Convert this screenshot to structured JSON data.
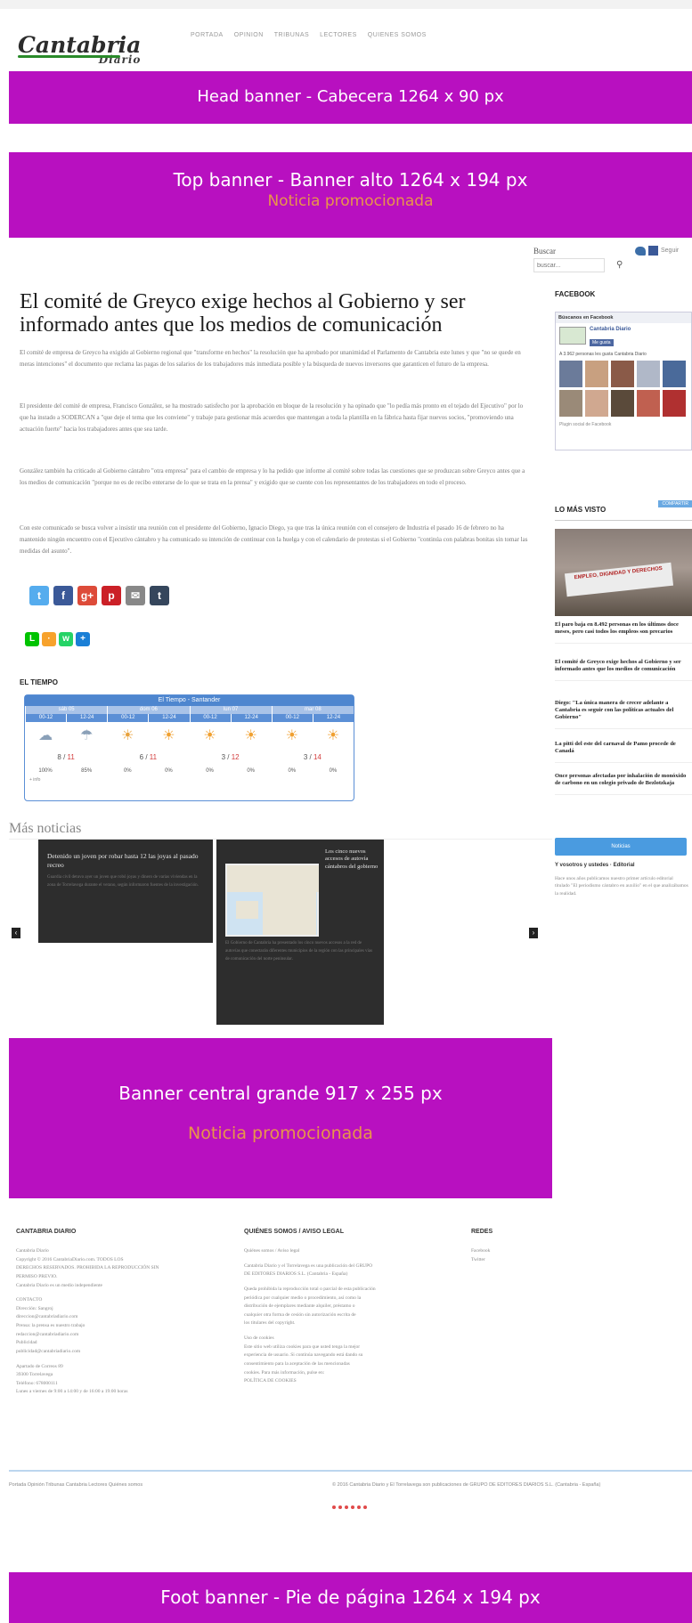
{
  "logo": {
    "name": "Cantabria",
    "sub": "Diario"
  },
  "nav": [
    "PORTADA",
    "OPINION",
    "TRIBUNAS",
    "LECTORES",
    "QUIENES SOMOS"
  ],
  "banners": {
    "head": "Head banner - Cabecera    1264 x 90 px",
    "top": "Top banner - Banner alto    1264 x 194 px",
    "top_promo": "Noticia promocionada",
    "central": "Banner central  grande  917 x 255 px",
    "central_promo": "Noticia promocionada",
    "foot": "Foot banner  - Pie de página  1264 x 194 px"
  },
  "search": {
    "label": "Buscar",
    "placeholder": "buscar...",
    "icon": "search-icon"
  },
  "social_top": {
    "label": "Seguir"
  },
  "article": {
    "title": "El comité de Greyco exige hechos al Gobierno y ser informado antes que los medios de comunicación",
    "paragraphs": [
      "El comité de empresa de Greyco ha exigido al Gobierno regional que \"transforme en hechos\" la resolución que ha aprobado por unanimidad el Parlamento de Cantabria este lunes y que \"no se quede en meras intenciones\" el documento que reclama las pagas de los salarios de los trabajadores más inmediata posible y la búsqueda de nuevos inversores que garanticen el futuro de la empresa.",
      "El presidente del comité de empresa, Francisco González, se ha mostrado satisfecho por la aprobación en bloque de la resolución y ha opinado que \"lo pedía más pronto en el tejado del Ejecutivo\" por lo que ha instado a SODERCAN a \"que deje el tema que les conviene\" y trabaje para gestionar más acuerdos que mantengan a toda la plantilla en la fábrica hasta fijar nuevos socios, \"promoviendo una actuación fuerte\" hacia los trabajadores antes que sea tarde.",
      "González también ha criticado al Gobierno cántabro \"otra empresa\" para el cambio de empresa y lo ha pedido que informe al comité sobre todas las cuestiones que se produzcan sobre Greyco antes que a los medios de comunicación \"porque no es de recibo enterarse de lo que se trata en la prensa\" y exigido que se cuente con los representantes de los trabajadores en todo el proceso.",
      "Con este comunicado se busca volver a insistir una reunión con el presidente del Gobierno, Ignacio Diego, ya que tras la única reunión con el consejero de Industria el pasado 16 de febrero no ha mantenido ningún encuentro con el Ejecutivo cántabro y ha comunicado su intención de continuar con la huelga y con el calendario de protestas si el Gobierno \"continúa con palabras bonitas sin tomar las medidas del asunto\"."
    ]
  },
  "share": {
    "primary": [
      {
        "icon": "twitter-icon",
        "glyph": "t",
        "color": "#55acee"
      },
      {
        "icon": "facebook-icon",
        "glyph": "f",
        "color": "#3b5998"
      },
      {
        "icon": "google-plus-icon",
        "glyph": "g+",
        "color": "#dd4b39"
      },
      {
        "icon": "pinterest-icon",
        "glyph": "p",
        "color": "#cb2027"
      },
      {
        "icon": "email-icon",
        "glyph": "✉",
        "color": "#888888"
      },
      {
        "icon": "tumblr-icon",
        "glyph": "t",
        "color": "#35465c"
      }
    ],
    "secondary": [
      {
        "icon": "line-icon",
        "glyph": "L",
        "color": "#00c300"
      },
      {
        "icon": "rss-icon",
        "glyph": "·",
        "color": "#f7a22c"
      },
      {
        "icon": "whatsapp-icon",
        "glyph": "w",
        "color": "#25d366"
      },
      {
        "icon": "more-icon",
        "glyph": "+",
        "color": "#1a7fd6"
      }
    ]
  },
  "weather": {
    "title": "EL TIEMPO",
    "header": "El Tiempo - Santander",
    "days": [
      "sáb 05",
      "dom 06",
      "lun 07",
      "mar 08"
    ],
    "hours": [
      "00-12",
      "12-24",
      "00-12",
      "12-24",
      "00-12",
      "12-24",
      "00-12",
      "12-24"
    ],
    "icons": [
      "☁",
      "☂",
      "☀",
      "☀",
      "☀",
      "☀",
      "☀",
      "☀"
    ],
    "temps": [
      {
        "lo": "8",
        "hi": "11"
      },
      {
        "lo": "6",
        "hi": "11"
      },
      {
        "lo": "3",
        "hi": "12"
      },
      {
        "lo": "3",
        "hi": "14"
      }
    ],
    "precip": [
      "100%",
      "85%",
      "0%",
      "0%",
      "0%",
      "0%",
      "0%",
      "0%"
    ],
    "footer": "+ info"
  },
  "mas_noticias": {
    "title": "Más noticias",
    "card1": {
      "title": "Detenido un joven por robar hasta 12 las joyas al pasado recreo",
      "text": "Guardia civil detuvo ayer un joven que robó joyas y dinero de varias viviendas en la zona de Torrelavega durante el verano, según informaron fuentes de la investigación."
    },
    "card2": {
      "title": "Los cinco nuevos accesos de autovía cántabros del gobierno",
      "text": "El Gobierno de Cantabria ha presentado los cinco nuevos accesos a la red de autovías que conectarán diferentes municipios de la región con las principales vías de comunicación del norte peninsular."
    }
  },
  "sidebar": {
    "facebook_title": "FACEBOOK",
    "fb_widget_top": "Búscanos en Facebook",
    "fb_page_name": "Cantabria Diario",
    "fb_like": "Me gusta",
    "fb_count": "A 3.962 personas les gusta Cantabria Diario",
    "fb_plugin": "Plugin social de Facebook",
    "lo_mas_visto": "LO MÁS VISTO",
    "lo_mas_visto_tag": "COMPARTIR",
    "photo_banner": "EMPLEO, DIGNIDAD Y DERECHOS",
    "items": [
      "El paro baja en 8.492 personas en los últimos doce meses, pero casi todos los empleos son precarios",
      "El comité de Greyco exige hechos al Gobierno y ser informado antes que los medios de comunicación",
      "Diego: \"La única manera de crecer adelante a Cantabria es seguir con las políticas actuales del Gobierno\"",
      "La pitti del este del carnaval de Pamo procede de Canadá",
      "Once personas afectadas por inhalación de monóxido de carbono en un colegio privado de Bezlotzkaja"
    ],
    "button": "Noticias",
    "tt_title": "Y vosotros y ustedes · Editorial",
    "tt_text": "Hace unos años publicamos nuestro primer artículo editorial titulado \"El periodismo cántabro en auxilio\" en el que analizábamos la realidad."
  },
  "footer": {
    "col1": {
      "title": "CANTABRIA DIARIO",
      "lines": [
        "Cantabria Diario",
        "Copyright © 2016 CantabriaDiario.com. TODOS LOS",
        "DERECHOS RESERVADOS. PROHIBIDA LA REPRODUCCIÓN SIN",
        "PERMISO PREVIO.",
        "Cantabria Diario es un medio independiente",
        "",
        "CONTACTO",
        "Dirección: Sangroj",
        "direccion@cantabriadiario.com",
        "Prensa: la prensa es nuestro trabajo",
        "redaccion@cantabriadiario.com",
        "Publicidad",
        "publicidad@cantabriadiario.com",
        "",
        "Apartado de Correos 89",
        "39300 Torrelavega",
        "Teléfono: 678000111",
        "Lunes a viernes de 9:00 a 14:00 y de 16:00 a 19:00 horas"
      ]
    },
    "col2": {
      "title": "QUIÉNES SOMOS / AVISO LEGAL",
      "lines": [
        "Quiénes somos / Aviso legal",
        "",
        "Cantabria Diario y el Torrelavega es una publicación del GRUPO",
        "DE EDITORES DIARIOS S.L. (Cantabria - España)",
        "",
        "Queda prohibida la reproducción total o parcial de esta publicación",
        "periódica por cualquier medio o procedimiento, así como la",
        "distribución de ejemplares mediante alquiler, préstamo o",
        "cualquier otra forma de cesión sin autorización escrita de",
        "los titulares del copyright.",
        "",
        "Uso de cookies",
        "Este sitio web utiliza cookies para que usted tenga la mejor",
        "experiencia de usuario. Si continúa navegando está dando su",
        "consentimiento para la aceptación de las mencionadas",
        "cookies. Para más información, pulse en:",
        "POLÍTICA DE COOKIES"
      ]
    },
    "col3": {
      "title": "REDES",
      "lines": [
        "Facebook",
        "Twitter"
      ]
    },
    "bottom_links": "Portada   Opinión   Tribunas   Cantabria   Lectores   Quiénes somos",
    "copyright": "© 2016 Cantabria Diario y El Torrelavega son publicaciones de GRUPO DE EDITORES DIARIOS S.L. (Cantabria - España)"
  }
}
